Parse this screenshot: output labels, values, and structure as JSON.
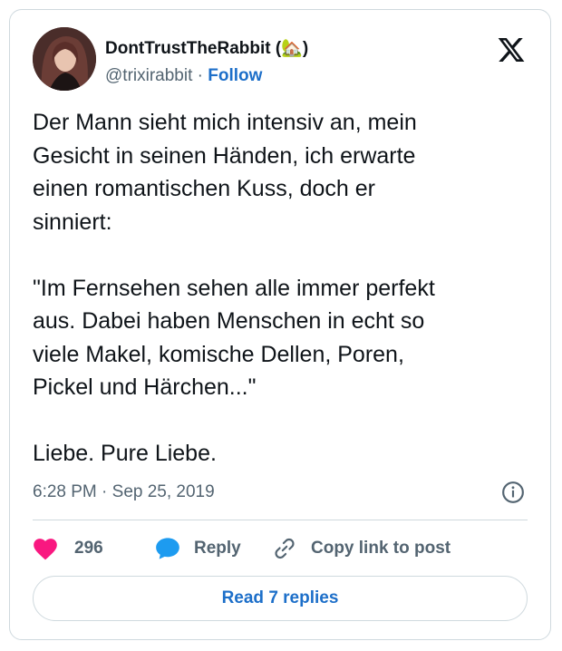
{
  "tweet": {
    "author_name": "DontTrustTheRabbit (🏡)",
    "handle": "@trixirabbit",
    "separator": "·",
    "follow_label": "Follow",
    "text": "Der Mann sieht mich intensiv an, mein\nGesicht in seinen Händen, ich erwarte\neinen romantischen Kuss, doch er\nsinniert:\n\n\"Im Fernsehen sehen alle immer perfekt\naus. Dabei haben Menschen in echt so\nviele Makel, komische Dellen, Poren,\nPickel und Härchen...\"\n\nLiebe. Pure Liebe.",
    "timestamp": "6:28 PM · Sep 25, 2019"
  },
  "actions": {
    "like_count": "296",
    "reply_label": "Reply",
    "copy_link_label": "Copy link to post"
  },
  "read_replies_label": "Read 7 replies",
  "colors": {
    "accent": "#1d6fc9",
    "like": "#f91880",
    "reply": "#1d9bf0",
    "muted": "#536471",
    "border": "#cfd9de"
  },
  "icons": [
    "x-logo-icon",
    "info-icon",
    "heart-icon",
    "reply-bubble-icon",
    "link-icon"
  ]
}
